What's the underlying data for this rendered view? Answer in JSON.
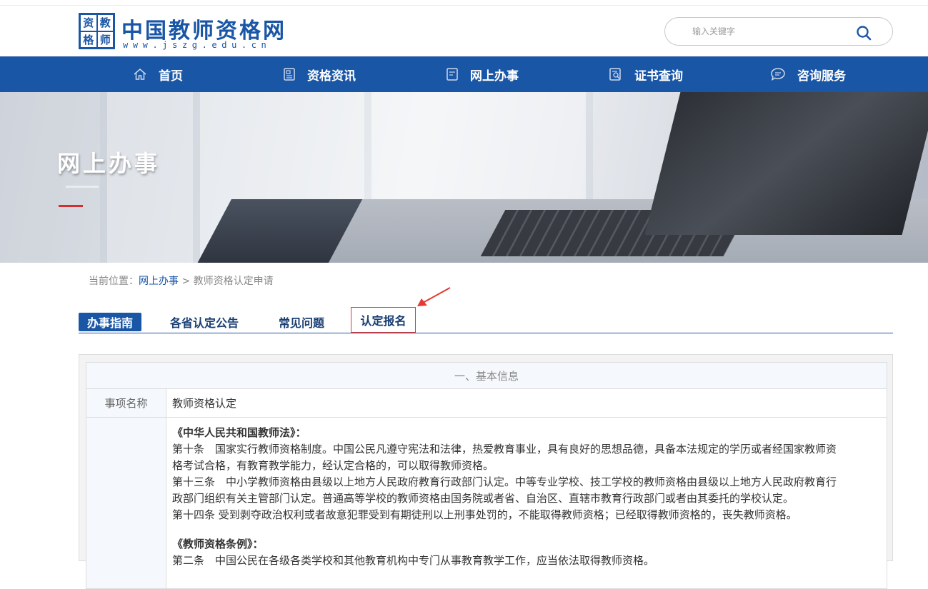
{
  "header": {
    "logo_chars": [
      "资",
      "教",
      "格",
      "师"
    ],
    "site_title": "中国教师资格网",
    "site_url": "www.jszg.edu.cn",
    "search_placeholder": "输入关键字"
  },
  "nav": {
    "items": [
      {
        "label": "首页",
        "icon": "home-icon"
      },
      {
        "label": "资格资讯",
        "icon": "news-icon"
      },
      {
        "label": "网上办事",
        "icon": "document-icon"
      },
      {
        "label": "证书查询",
        "icon": "certificate-search-icon"
      },
      {
        "label": "咨询服务",
        "icon": "chat-icon"
      }
    ],
    "color": "#1a56a6"
  },
  "banner": {
    "title": "网上办事"
  },
  "breadcrumb": {
    "prefix": "当前位置：",
    "link": "网上办事",
    "separator": " > ",
    "current": "教师资格认定申请"
  },
  "tabs": [
    {
      "label": "办事指南",
      "active": true
    },
    {
      "label": "各省认定公告",
      "active": false
    },
    {
      "label": "常见问题",
      "active": false
    },
    {
      "label": "认定报名",
      "active": false,
      "highlighted": true
    }
  ],
  "content": {
    "section_title": "一、基本信息",
    "rows": [
      {
        "key": "事项名称",
        "value": "教师资格认定"
      }
    ],
    "law1_title": "《中华人民共和国教师法》：",
    "law1_lines": [
      "第十条　国家实行教师资格制度。中国公民凡遵守宪法和法律，热爱教育事业，具有良好的思想品德，具备本法规定的学历或者经国家教师资",
      "格考试合格，有教育教学能力，经认定合格的，可以取得教师资格。",
      "第十三条　中小学教师资格由县级以上地方人民政府教育行政部门认定。中等专业学校、技工学校的教师资格由县级以上地方人民政府教育行",
      "政部门组织有关主管部门认定。普通高等学校的教师资格由国务院或者省、自治区、直辖市教育行政部门或者由其委托的学校认定。",
      "第十四条 受到剥夺政治权利或者故意犯罪受到有期徒刑以上刑事处罚的，不能取得教师资格；已经取得教师资格的，丧失教师资格。"
    ],
    "law2_title": "《教师资格条例》：",
    "law2_line": "第二条　中国公民在各级各类学校和其他教育机构中专门从事教育教学工作，应当依法取得教师资格。"
  }
}
